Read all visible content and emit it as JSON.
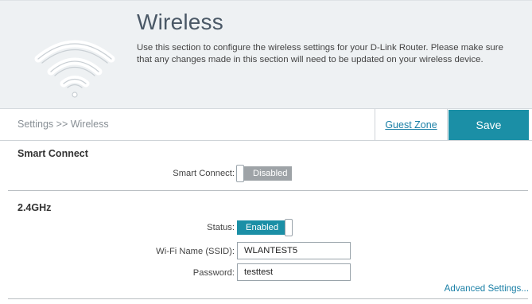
{
  "header": {
    "title": "Wireless",
    "description": "Use this section to configure the wireless settings for your D-Link Router. Please make sure that any changes made in this section will need to be updated on your wireless device.",
    "logo_icon": "wifi-icon"
  },
  "settings_bar": {
    "breadcrumb": "Settings >> Wireless",
    "guest_zone_label": "Guest Zone",
    "save_label": "Save"
  },
  "smart_connect": {
    "section_title": "Smart Connect",
    "label": "Smart Connect:",
    "toggle_state": "Disabled"
  },
  "band_24": {
    "section_title": "2.4GHz",
    "status_label": "Status:",
    "status_state": "Enabled",
    "ssid_label": "Wi-Fi Name (SSID):",
    "ssid_value": "WLANTEST5",
    "password_label": "Password:",
    "password_value": "testtest",
    "advanced_link": "Advanced Settings..."
  },
  "colors": {
    "accent": "#1b8fa6",
    "banner_bg": "#eef1f3",
    "disabled_gray": "#9ea3a7",
    "link": "#1a7fa6"
  }
}
